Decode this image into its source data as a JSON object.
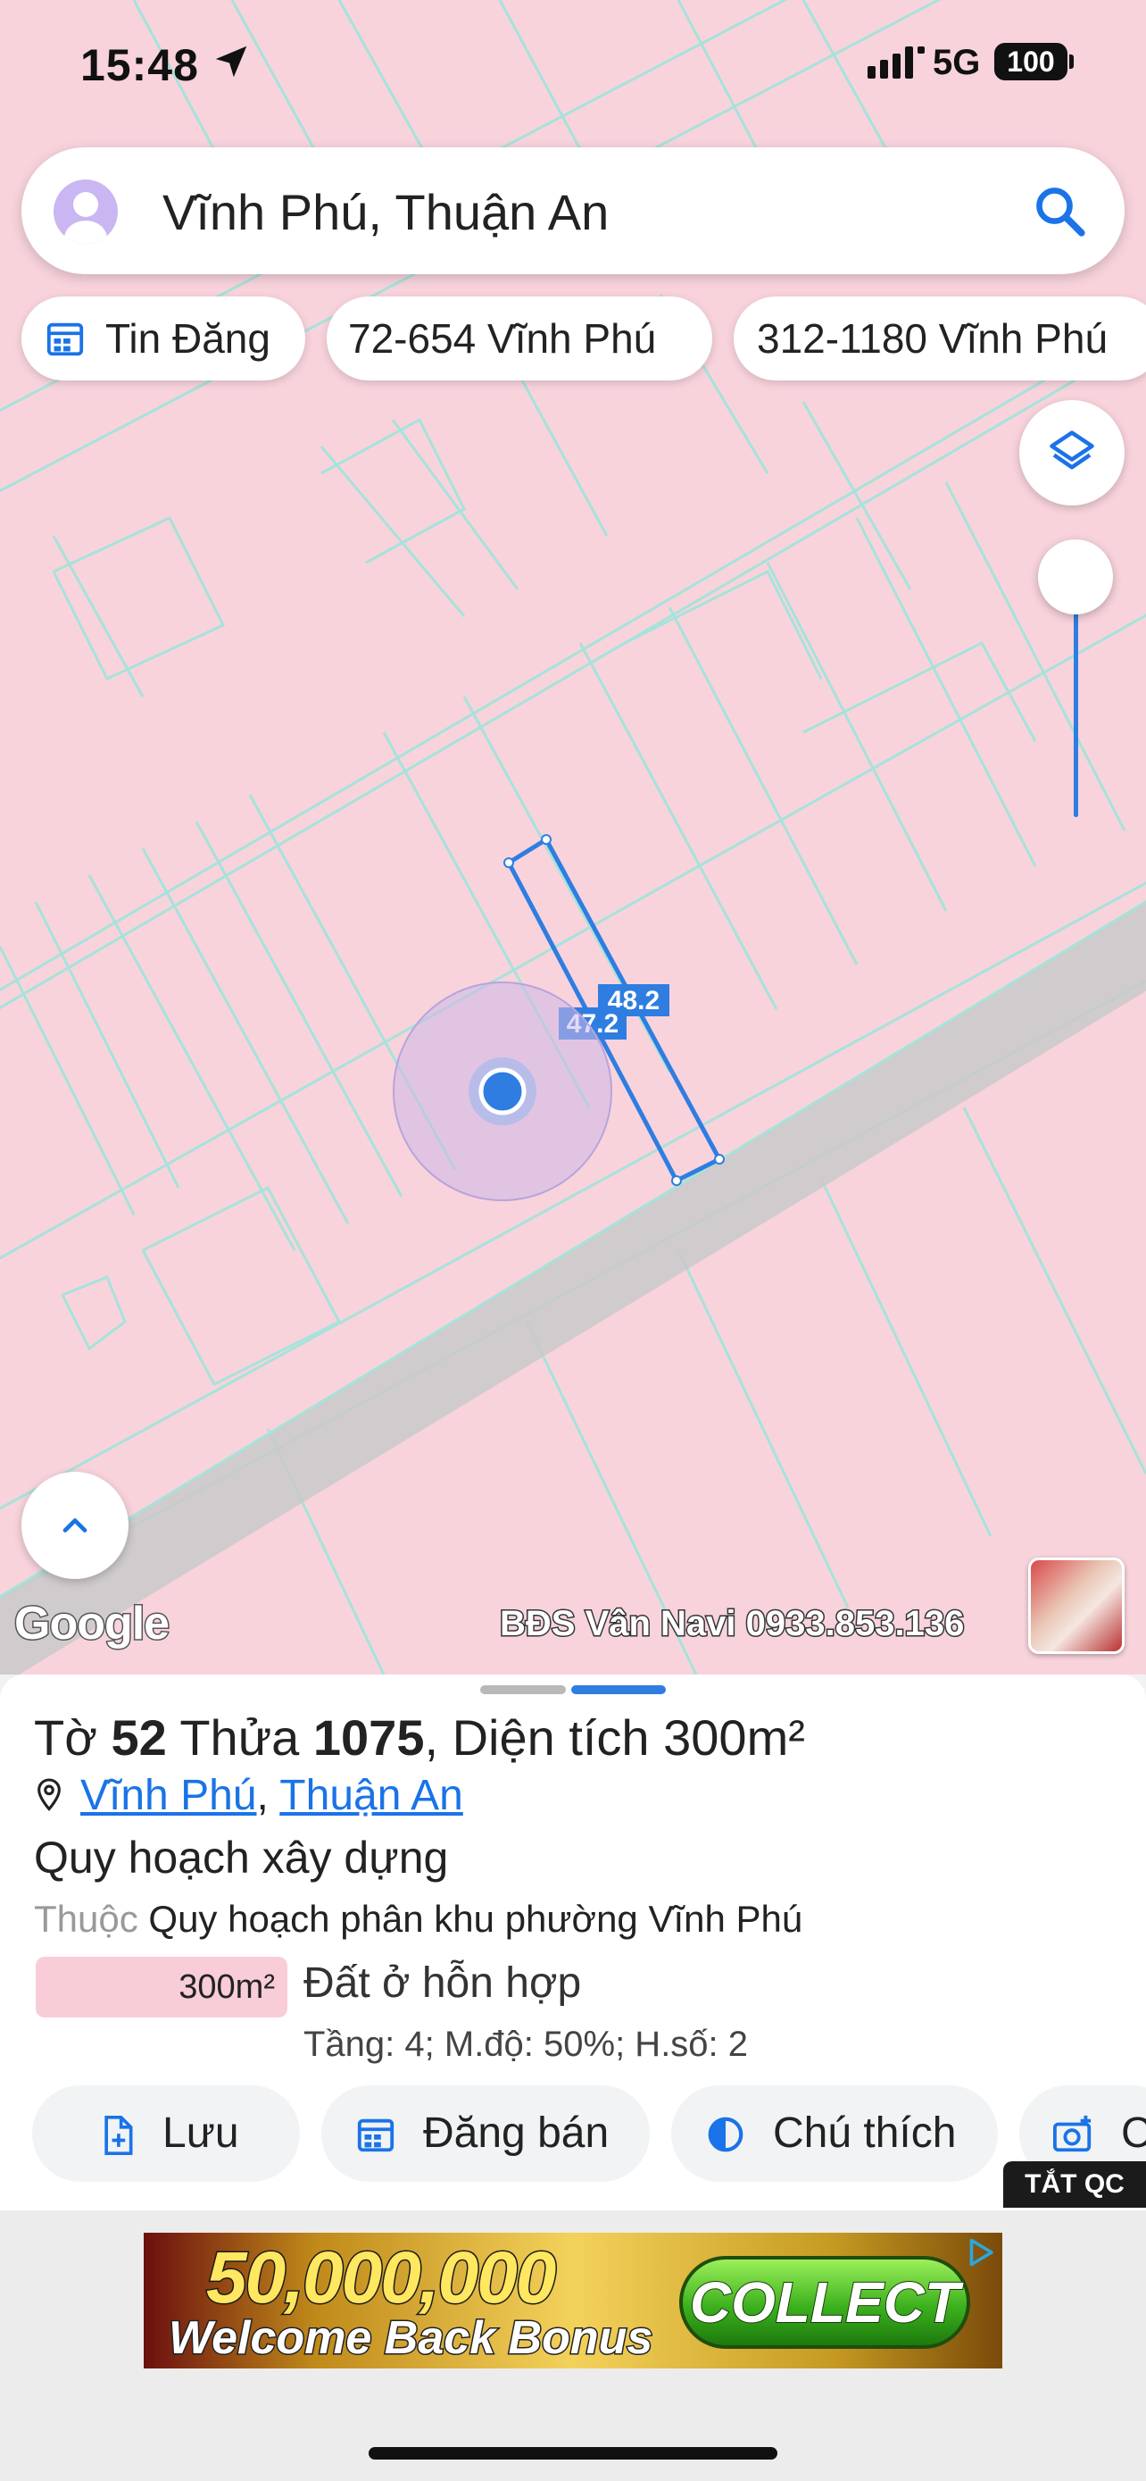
{
  "status_bar": {
    "time": "15:48",
    "network": "5G",
    "battery": "100"
  },
  "search": {
    "query": "Vĩnh Phú, Thuận An"
  },
  "chips": [
    {
      "label": "Tin Đăng",
      "icon": "calendar-icon"
    },
    {
      "label": "72-654 Vĩnh Phú"
    },
    {
      "label": "312-1180 Vĩnh Phú"
    }
  ],
  "map": {
    "measure_a": "48.2",
    "measure_b": "47.2",
    "google_label": "Google",
    "watermark": "BĐS Vân Navi 0933.853.136",
    "fill_color": "#f8d3dc",
    "line_color": "#9fe0d8",
    "road_color": "#c8c8c8",
    "plot_color": "#2f7de1"
  },
  "sheet": {
    "title_prefix": "Tờ",
    "sheet_no": "52",
    "lot_label": "Thửa",
    "lot_no": "1075",
    "area_label": ", Diện tích",
    "area_value": "300m²",
    "ward": "Vĩnh Phú",
    "separator": ",",
    "city": "Thuận An",
    "section_title": "Quy hoạch xây dựng",
    "belongs_label": "Thuộc",
    "belongs_value": "Quy hoạch phân khu phường Vĩnh Phú",
    "zone_area": "300m²",
    "zone_name": "Đất ở hỗn hợp",
    "zone_detail": "Tầng: 4; M.độ: 50%; H.số: 2",
    "actions": [
      "Lưu",
      "Đăng bán",
      "Chú thích",
      "C"
    ]
  },
  "ad": {
    "close_label": "TẮT QC",
    "headline": "50,000,000",
    "subline": "Welcome Back Bonus",
    "cta": "COLLECT"
  }
}
